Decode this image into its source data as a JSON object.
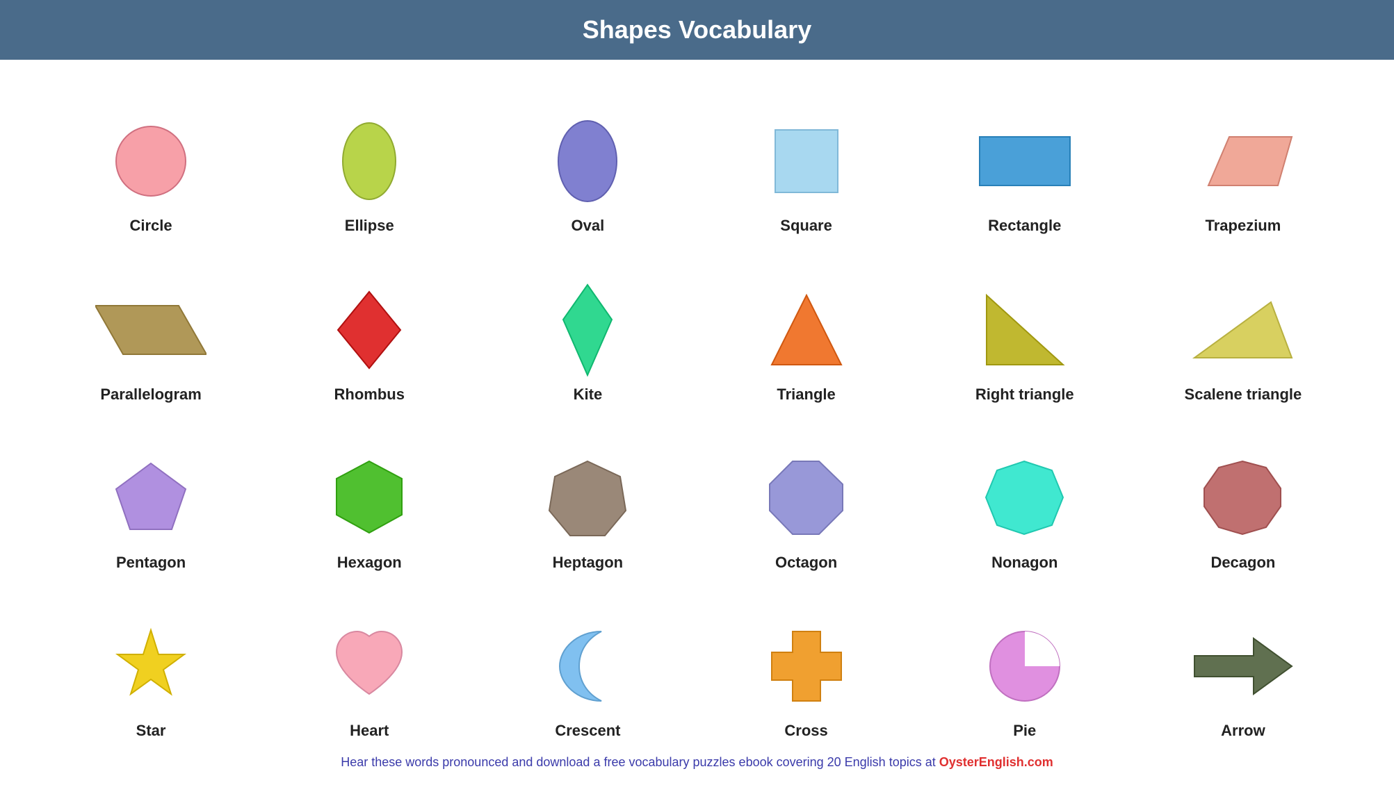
{
  "header": {
    "title": "Shapes Vocabulary"
  },
  "shapes": [
    {
      "id": "circle",
      "label": "Circle",
      "color": "#f7a0a8"
    },
    {
      "id": "ellipse",
      "label": "Ellipse",
      "color": "#b8d44a"
    },
    {
      "id": "oval",
      "label": "Oval",
      "color": "#8080d0"
    },
    {
      "id": "square",
      "label": "Square",
      "color": "#a8d8f0"
    },
    {
      "id": "rectangle",
      "label": "Rectangle",
      "color": "#4aa0d8"
    },
    {
      "id": "trapezium",
      "label": "Trapezium",
      "color": "#f0a898"
    },
    {
      "id": "parallelogram",
      "label": "Parallelogram",
      "color": "#b09858"
    },
    {
      "id": "rhombus",
      "label": "Rhombus",
      "color": "#e03030"
    },
    {
      "id": "kite",
      "label": "Kite",
      "color": "#30d890"
    },
    {
      "id": "triangle",
      "label": "Triangle",
      "color": "#f07830"
    },
    {
      "id": "right-triangle",
      "label": "Right triangle",
      "color": "#c0b830"
    },
    {
      "id": "scalene-triangle",
      "label": "Scalene triangle",
      "color": "#d8d060"
    },
    {
      "id": "pentagon",
      "label": "Pentagon",
      "color": "#b090e0"
    },
    {
      "id": "hexagon",
      "label": "Hexagon",
      "color": "#50c030"
    },
    {
      "id": "heptagon",
      "label": "Heptagon",
      "color": "#9a8878"
    },
    {
      "id": "octagon",
      "label": "Octagon",
      "color": "#9898d8"
    },
    {
      "id": "nonagon",
      "label": "Nonagon",
      "color": "#40e8d0"
    },
    {
      "id": "decagon",
      "label": "Decagon",
      "color": "#c07070"
    },
    {
      "id": "star",
      "label": "Star",
      "color": "#f0d020"
    },
    {
      "id": "heart",
      "label": "Heart",
      "color": "#f8a8b8"
    },
    {
      "id": "crescent",
      "label": "Crescent",
      "color": "#80c0f0"
    },
    {
      "id": "cross",
      "label": "Cross",
      "color": "#f0a030"
    },
    {
      "id": "pie",
      "label": "Pie",
      "color": "#e090e0"
    },
    {
      "id": "arrow",
      "label": "Arrow",
      "color": "#607050"
    }
  ],
  "footer": {
    "text": "Hear these words pronounced and download a free vocabulary puzzles ebook covering 20 English topics at ",
    "link_text": "OysterEnglish.com"
  }
}
